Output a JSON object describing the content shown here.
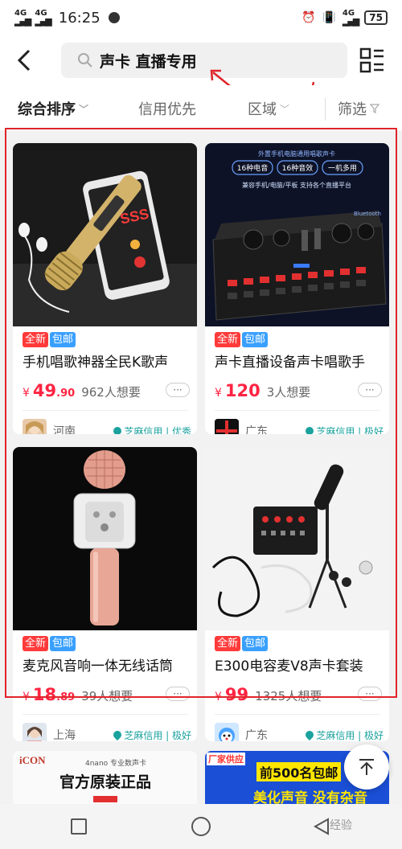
{
  "status_bar": {
    "network1": "4G",
    "network2": "4G",
    "time": "16:25",
    "network3": "4G",
    "battery": "75"
  },
  "header": {
    "search_text": "声卡 直播专用"
  },
  "filters": {
    "sort": "综合排序",
    "credit": "信用优先",
    "region": "区域",
    "filter": "筛选"
  },
  "colors": {
    "price": "#ff2442",
    "tag_new": "#ff3a3a",
    "tag_free": "#3aa0ff",
    "credit": "#1aa29e",
    "annotation": "#e0252a"
  },
  "products": [
    {
      "tag_new": "全新",
      "tag_free": "包邮",
      "title": "手机唱歌神器全民K歌声",
      "currency": "¥",
      "price_int": "49",
      "price_dec": ".90",
      "wants": "962人想要",
      "more": "···",
      "region": "河南",
      "credit": "芝麻信用 | 优秀"
    },
    {
      "tag_new": "全新",
      "tag_free": "包邮",
      "title": "声卡直播设备声卡唱歌手",
      "currency": "¥",
      "price_int": "120",
      "price_dec": "",
      "wants": "3人想要",
      "more": "···",
      "region": "广东",
      "credit": "芝麻信用 | 极好",
      "image_texts": [
        "外置手机电脑通用唱歌声卡",
        "16种电音",
        "16种音效",
        "一机多用",
        "兼容手机/电脑/平板 支持各个直播平台",
        "Bluetooth"
      ]
    },
    {
      "tag_new": "全新",
      "tag_free": "包邮",
      "title": "麦克风音响一体无线话筒",
      "currency": "¥",
      "price_int": "18",
      "price_dec": ".89",
      "wants": "39人想要",
      "more": "···",
      "region": "上海",
      "credit": "芝麻信用 | 极好"
    },
    {
      "tag_new": "全新",
      "tag_free": "包邮",
      "title": "E300电容麦V8声卡套装",
      "currency": "¥",
      "price_int": "99",
      "price_dec": "",
      "wants": "1325人想要",
      "more": "···",
      "region": "广东",
      "credit": "芝麻信用 | 极好"
    }
  ],
  "partial_cards": [
    {
      "brand": "iCON",
      "subtitle": "4nano 专业数声卡",
      "headline": "官方原装正品"
    },
    {
      "corner": "厂家供应",
      "headline": "前500名包邮",
      "sub": "美化声音 没有杂音"
    }
  ],
  "watermark": "经验"
}
